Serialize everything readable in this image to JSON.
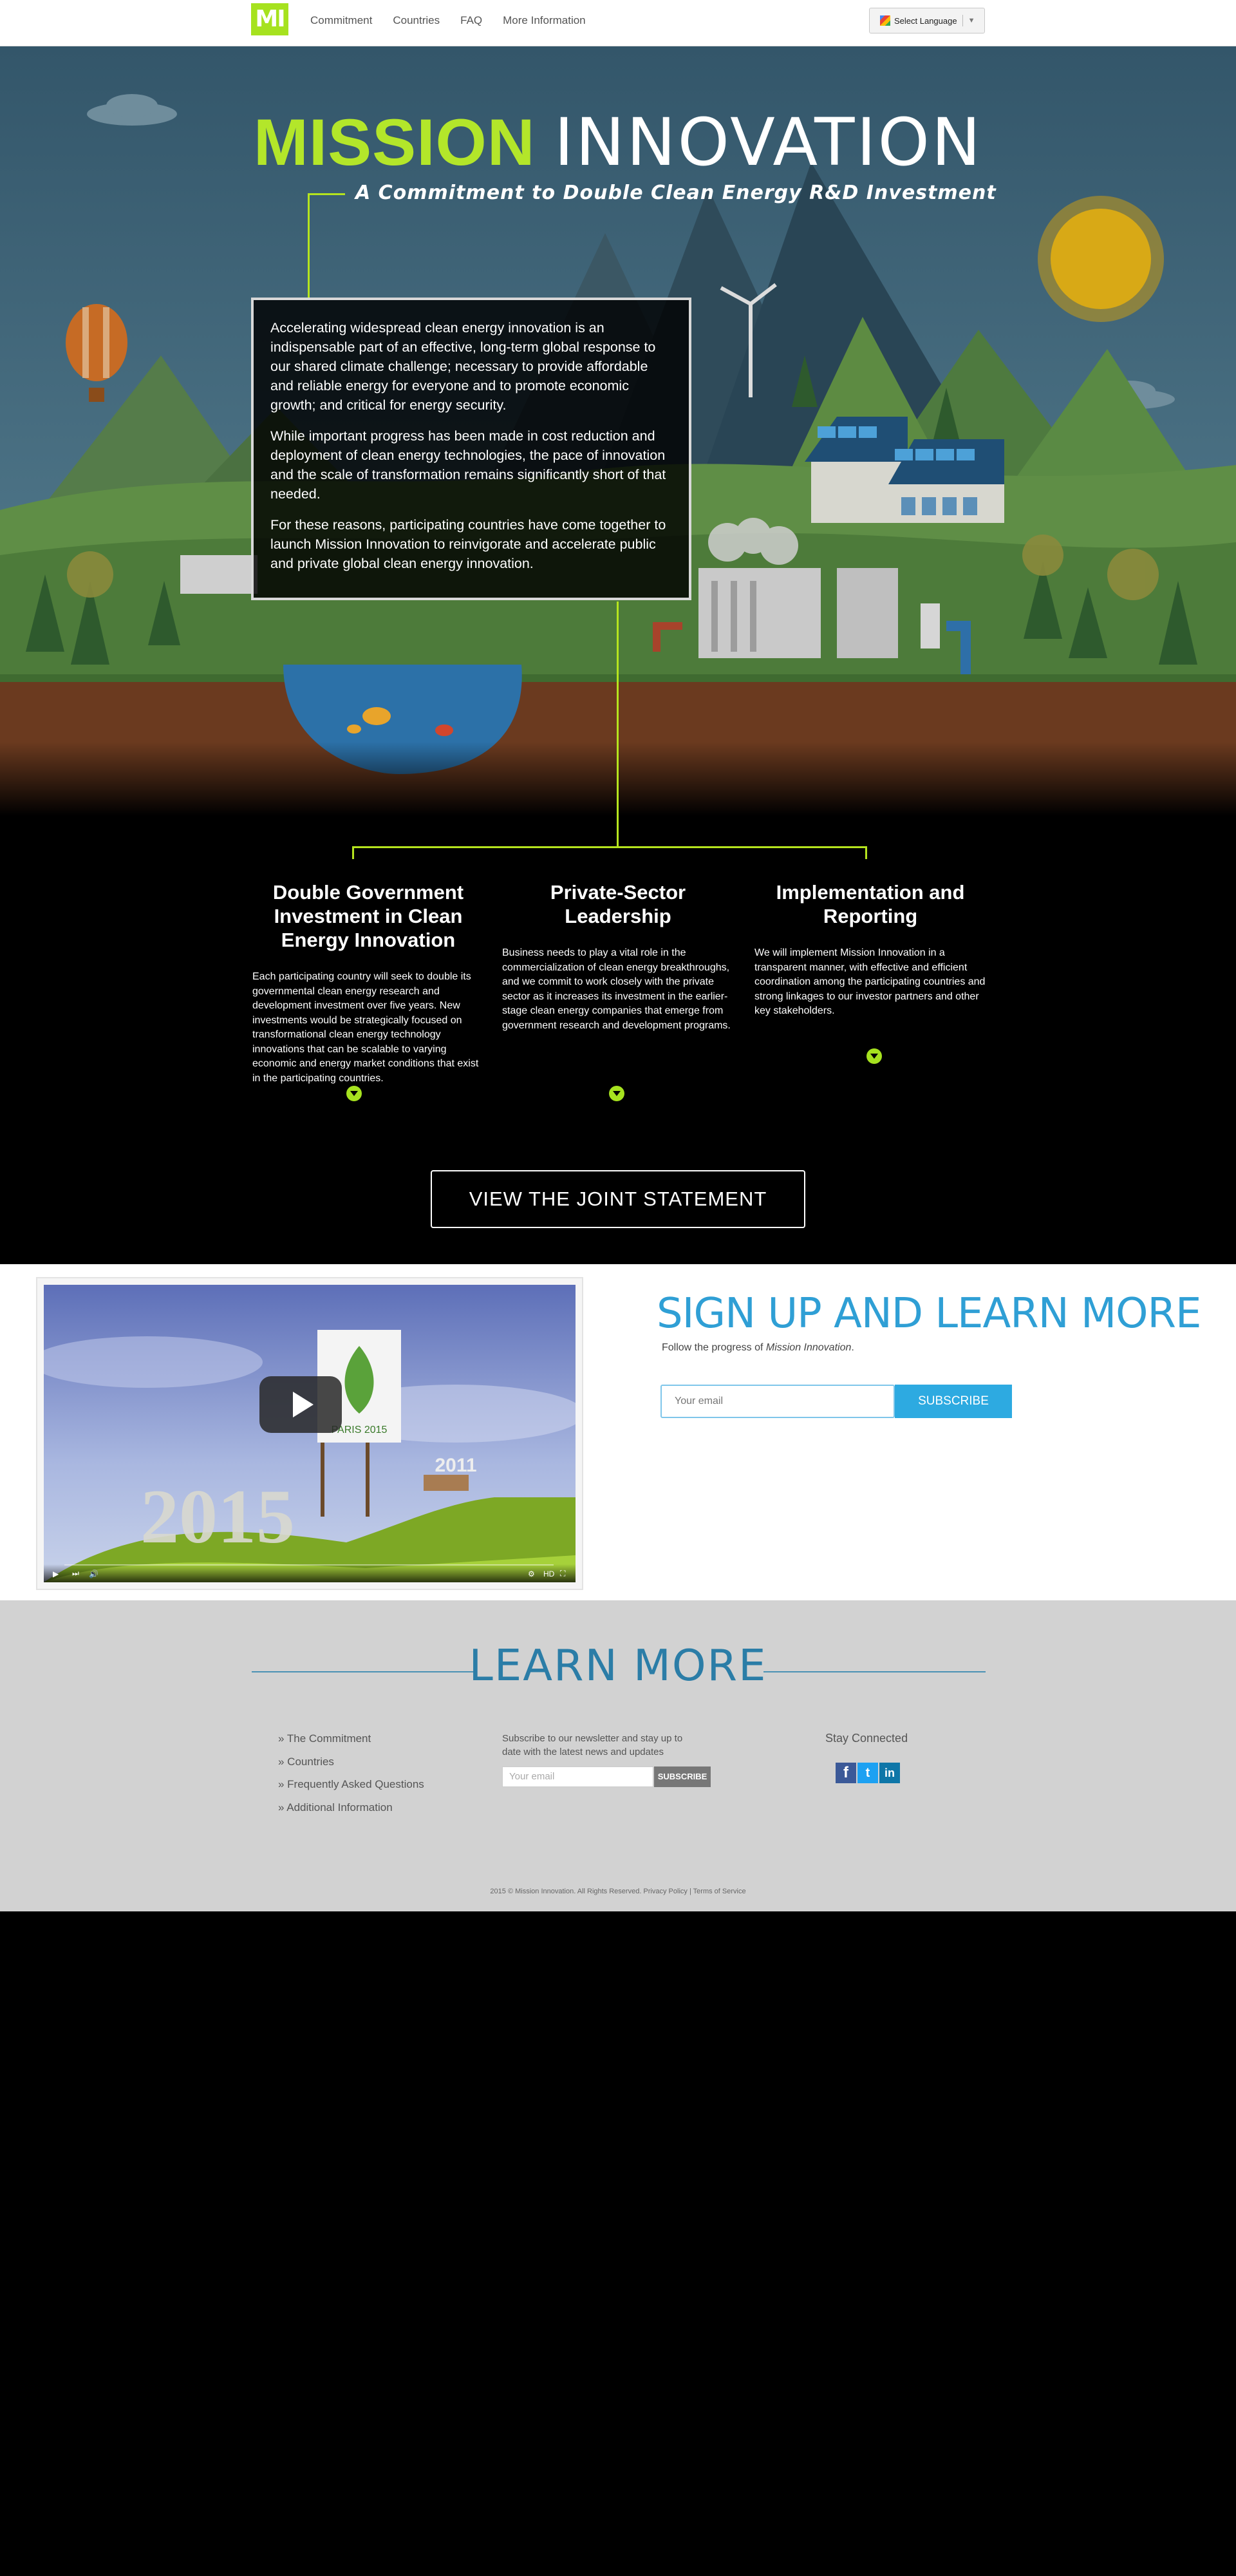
{
  "header": {
    "logo": "MI",
    "nav": [
      "Commitment",
      "Countries",
      "FAQ",
      "More Information"
    ],
    "language": {
      "label": "Select Language",
      "arrow": "▼"
    }
  },
  "hero": {
    "title_a": "MISSION",
    "title_b": "INNOVATION",
    "subtitle": "A Commitment to Double Clean Energy R&D Investment",
    "paragraphs": [
      "Accelerating widespread clean energy innovation is an indispensable part of an effective, long-term global response to our shared climate challenge; necessary to provide affordable and reliable energy for everyone and to promote economic growth; and critical for energy security.",
      "While important progress has been made in cost reduction and deployment of clean energy technologies, the pace of innovation and the scale of transformation remains significantly short of that needed.",
      "For these reasons, participating countries have come together to launch Mission Innovation to reinvigorate and accelerate public and private global clean energy innovation."
    ]
  },
  "pillars": [
    {
      "title": "Double Government Investment in Clean Energy Innovation",
      "body": "Each participating country will seek to double its governmental clean energy research and development investment over five years. New investments would be strategically focused on transformational clean energy technology innovations that can be scalable to varying economic and energy market conditions that exist in the participating countries."
    },
    {
      "title": "Private-Sector Leadership",
      "body": "Business needs to play a vital role in the commercialization of clean energy breakthroughs, and we commit to work closely with the private sector as it increases its investment in the earlier-stage clean energy companies that emerge from government research and development programs."
    },
    {
      "title": "Implementation and Reporting",
      "body": "We will implement Mission Innovation in a transparent manner, with effective and efficient coordination among the participating countries and strong linkages to our investor partners and other key stakeholders."
    }
  ],
  "joint_statement": "VIEW THE JOINT STATEMENT",
  "signup": {
    "heading": "SIGN UP AND LEARN MORE",
    "follow_prefix": "Follow the progress of ",
    "follow_em": "Mission Innovation",
    "follow_suffix": ".",
    "email_placeholder": "Your email",
    "subscribe": "SUBSCRIBE",
    "video": {
      "sign_text": "PARIS 2015",
      "big_year": "2015",
      "small_year": "2011",
      "hd": "HD"
    }
  },
  "learn": {
    "heading": "LEARN MORE",
    "links": [
      "» The Commitment",
      "» Countries",
      "» Frequently Asked Questions",
      "» Additional Information"
    ],
    "newsletter": "Subscribe to our newsletter and stay up to date with the latest news and updates",
    "news_placeholder": "Your email",
    "news_button": "SUBSCRIBE",
    "stay_connected": "Stay Connected",
    "social": [
      {
        "name": "facebook-icon",
        "glyph": "f",
        "color": "#3b5998"
      },
      {
        "name": "twitter-icon",
        "glyph": "t",
        "color": "#1da1f2"
      },
      {
        "name": "linkedin-icon",
        "glyph": "in",
        "color": "#0e76a8"
      }
    ],
    "copyright": "2015 © Mission Innovation. All Rights Reserved. Privacy Policy | Terms of Service"
  },
  "colors": {
    "accent_green": "#a6e21f",
    "accent_blue": "#2daae1",
    "learn_blue": "#2b7da7",
    "footer_bg": "#d2d2d2"
  }
}
